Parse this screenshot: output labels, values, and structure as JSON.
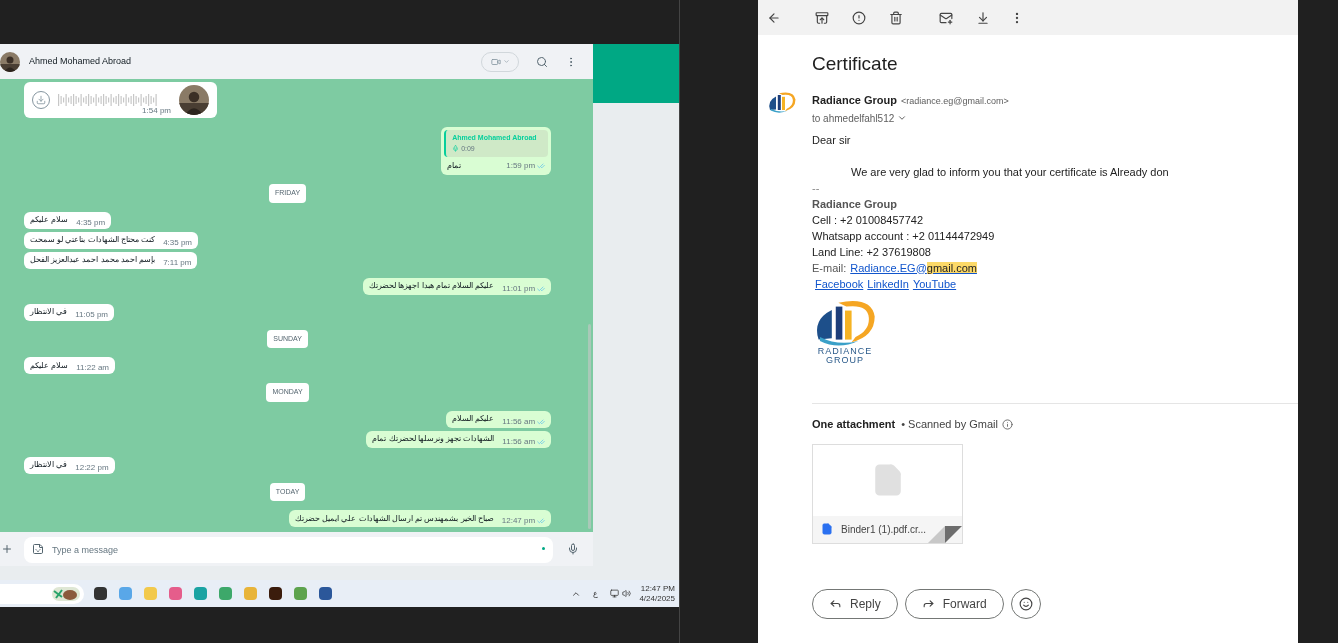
{
  "chat": {
    "contact": "Ahmed Mohamed Abroad",
    "messages": [
      {
        "kind": "voice",
        "time": "1:54 pm"
      },
      {
        "kind": "quote",
        "author": "Ahmed Mohamed Abroad",
        "duration": "0:09",
        "text": "تمام",
        "time": "1:59 pm"
      },
      {
        "kind": "date",
        "text": "FRIDAY"
      },
      {
        "kind": "in",
        "text": "سلام عليكم",
        "time": "4:35 pm"
      },
      {
        "kind": "in",
        "text": "كنت محتاج الشهادات بتاعتي لو سمحت",
        "time": "4:35 pm"
      },
      {
        "kind": "in",
        "text": "بإسم احمد محمد احمد عبدالعزيز الفحل",
        "time": "7:11 pm"
      },
      {
        "kind": "out",
        "text": "عليكم السلام تمام هبدا اجهزها لحضرتك",
        "time": "11:01 pm"
      },
      {
        "kind": "in",
        "text": "في الانتظار",
        "time": "11:05 pm"
      },
      {
        "kind": "date",
        "text": "SUNDAY"
      },
      {
        "kind": "in",
        "text": "سلام عليكم",
        "time": "11:22 am"
      },
      {
        "kind": "date",
        "text": "MONDAY"
      },
      {
        "kind": "out",
        "text": "عليكم السلام",
        "time": "11:56 am"
      },
      {
        "kind": "out",
        "text": "الشهادات تجهز ونرسلها لحضرتك تمام",
        "time": "11:56 am"
      },
      {
        "kind": "in",
        "text": "في الانتظار",
        "time": "12:22 pm"
      },
      {
        "kind": "date",
        "text": "TODAY"
      },
      {
        "kind": "out",
        "text": "صباح الخير بشمهندس تم ارسال الشهادات علي ايميل حضرتك",
        "time": "12:47 pm"
      }
    ],
    "input": {
      "placeholder": "Type a message"
    }
  },
  "taskbar": {
    "language": "ع",
    "time": "12:47 PM",
    "date": "4/24/2025"
  },
  "email": {
    "subject": "Certificate",
    "sender": "Radiance Group",
    "sender_address": "<radiance.eg@gmail.com>",
    "recipient": "to ahmedelfahl512",
    "body": [
      {
        "kind": "text",
        "text": "Dear sir"
      },
      {
        "kind": "indent",
        "text": "We are very glad to inform you that your certificate is Already don"
      },
      {
        "kind": "muted",
        "text": "--"
      },
      {
        "kind": "bold",
        "text": "Radiance Group"
      },
      {
        "kind": "text",
        "text": "Cell : +2 01008457742"
      },
      {
        "kind": "text",
        "text": "Whatsapp account : +2 01144472949"
      },
      {
        "kind": "text",
        "text": "Land Line: +2 37619808"
      }
    ],
    "email_line": {
      "label": "E-mail:",
      "link": [
        "Radiance.EG@",
        "gmail.com"
      ]
    },
    "social_links": [
      "Facebook",
      "LinkedIn",
      "YouTube"
    ],
    "logo_text": [
      "RADIANCE",
      "GROUP"
    ],
    "attachments_title": "One attachment",
    "scan_note": "• Scanned by Gmail",
    "attachment": {
      "name": "Binder1 (1).pdf.cr..."
    },
    "actions": [
      "Reply",
      "Forward"
    ]
  }
}
